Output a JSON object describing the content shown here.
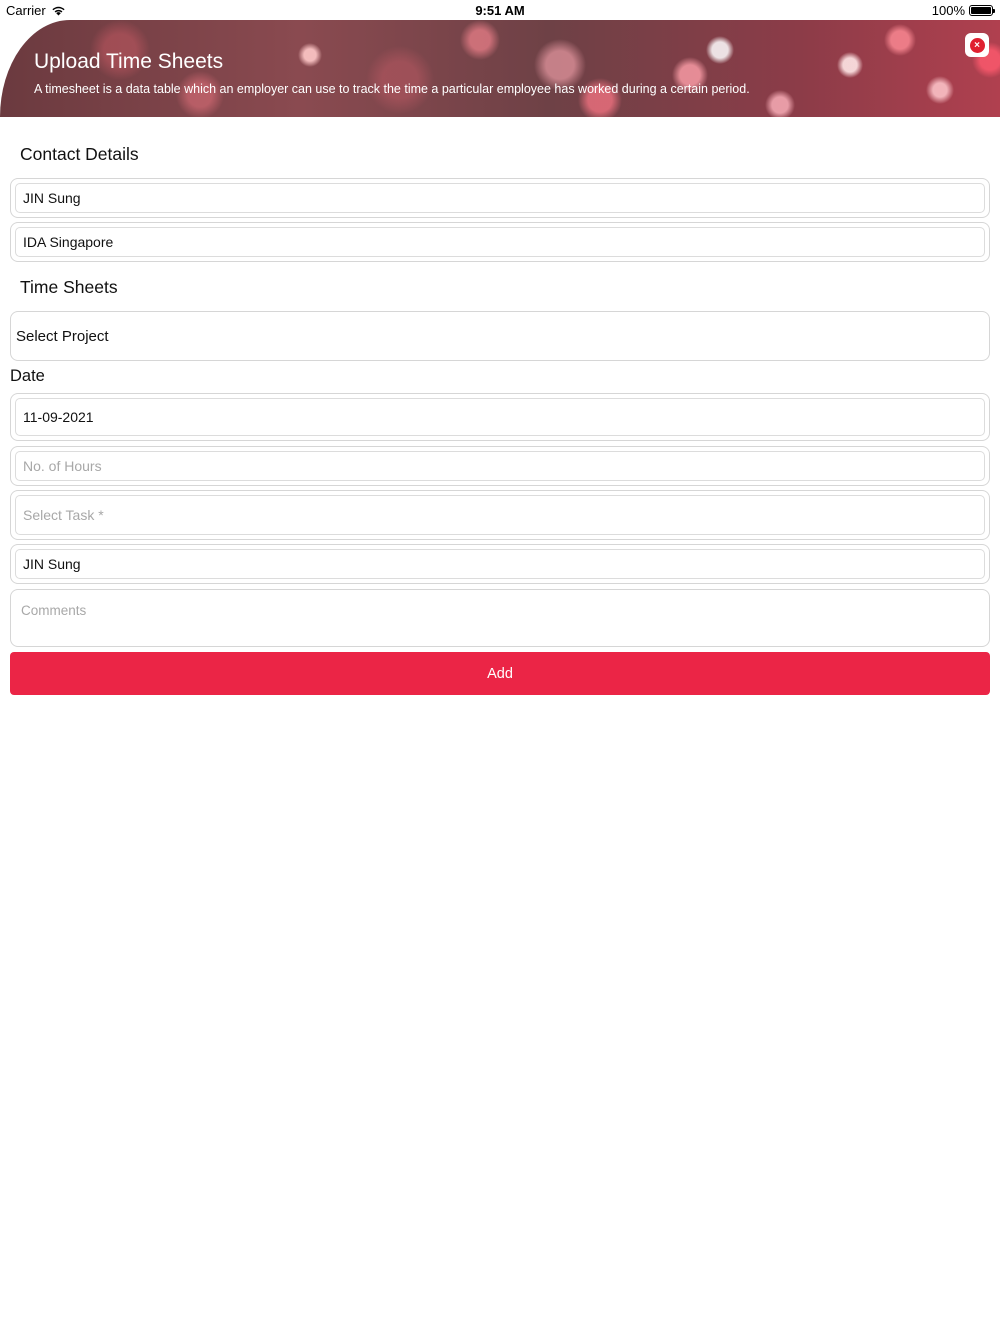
{
  "status_bar": {
    "carrier": "Carrier",
    "time": "9:51 AM",
    "battery": "100%"
  },
  "header": {
    "title": "Upload Time Sheets",
    "description": "A timesheet is a data table which an employer can use to track the time a particular employee has worked during a certain period.",
    "close_icon": "close-icon",
    "close_symbol": "×"
  },
  "contact_details": {
    "title": "Contact Details",
    "name_value": "JIN Sung",
    "company_value": "IDA Singapore"
  },
  "time_sheets": {
    "title": "Time Sheets",
    "project_select": "Select Project",
    "date_label": "Date",
    "date_value": "11-09-2021",
    "hours_placeholder": "No. of Hours",
    "task_placeholder": "Select Task *",
    "assignee_value": "JIN Sung",
    "comments_placeholder": "Comments",
    "add_label": "Add"
  },
  "colors": {
    "accent": "#eb2546",
    "close": "#e02030"
  }
}
